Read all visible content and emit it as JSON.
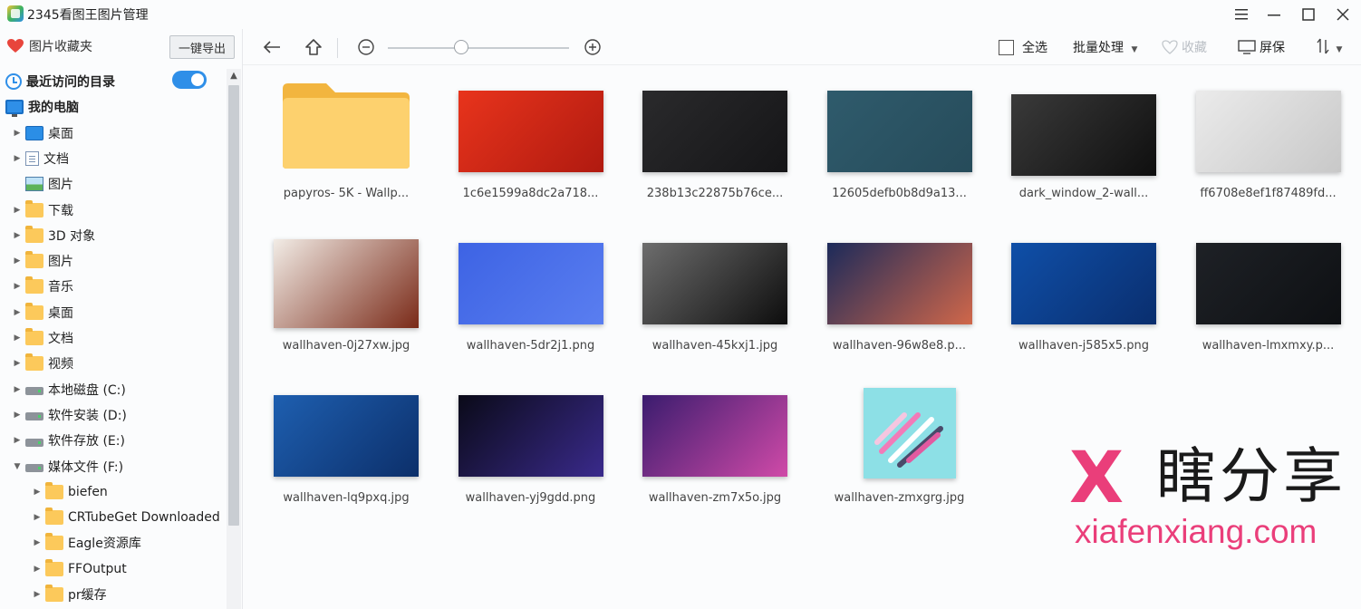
{
  "window": {
    "title": "2345看图王图片管理",
    "min_icon": "minimize-icon",
    "max_icon": "maximize-icon",
    "close_icon": "close-icon"
  },
  "sidebar": {
    "favorites_label": "图片收藏夹",
    "export_label": "一键导出",
    "tree": [
      {
        "label": "最近访问的目录",
        "icon": "clock-icon",
        "bold": true,
        "toggle": true
      },
      {
        "label": "我的电脑",
        "icon": "monitor-icon",
        "bold": true
      },
      {
        "label": "桌面",
        "icon": "desktop-icon",
        "arrow": "right"
      },
      {
        "label": "文档",
        "icon": "document-icon",
        "arrow": "right"
      },
      {
        "label": "图片",
        "icon": "picture-icon"
      },
      {
        "label": "下载",
        "icon": "folder-icon",
        "arrow": "right"
      },
      {
        "label": "3D 对象",
        "icon": "folder-icon",
        "arrow": "right"
      },
      {
        "label": "图片",
        "icon": "folder-icon",
        "arrow": "right"
      },
      {
        "label": "音乐",
        "icon": "folder-icon",
        "arrow": "right"
      },
      {
        "label": "桌面",
        "icon": "folder-icon",
        "arrow": "right"
      },
      {
        "label": "文档",
        "icon": "folder-icon",
        "arrow": "right"
      },
      {
        "label": "视频",
        "icon": "folder-icon",
        "arrow": "right"
      },
      {
        "label": "本地磁盘 (C:)",
        "icon": "drive-icon",
        "arrow": "right"
      },
      {
        "label": "软件安装 (D:)",
        "icon": "drive-icon",
        "arrow": "right"
      },
      {
        "label": "软件存放 (E:)",
        "icon": "drive-icon",
        "arrow": "right"
      },
      {
        "label": "媒体文件 (F:)",
        "icon": "drive-icon",
        "arrow": "down"
      },
      {
        "label": "biefen",
        "icon": "folder-icon",
        "arrow": "right",
        "level": 2
      },
      {
        "label": "CRTubeGet Downloaded",
        "icon": "folder-icon",
        "arrow": "right",
        "level": 2
      },
      {
        "label": "Eagle资源库",
        "icon": "folder-icon",
        "arrow": "right",
        "level": 2
      },
      {
        "label": "FFOutput",
        "icon": "folder-icon",
        "arrow": "right",
        "level": 2
      },
      {
        "label": "pr缓存",
        "icon": "folder-icon",
        "arrow": "right",
        "level": 2
      }
    ]
  },
  "toolbar": {
    "back_icon": "back-arrow-icon",
    "up_icon": "up-arrow-icon",
    "zoom_out_icon": "zoom-out-icon",
    "zoom_in_icon": "zoom-in-icon",
    "select_all_label": "全选",
    "batch_label": "批量处理",
    "favorite_label": "收藏",
    "fullscreen_label": "屏保",
    "sort_icon": "sort-icon"
  },
  "files": [
    {
      "name": "papyros- 5K - Wallp...",
      "type": "folder"
    },
    {
      "name": "1c6e1599a8dc2a718...",
      "colors": [
        "#e8341c",
        "#b01a10"
      ]
    },
    {
      "name": "238b13c22875b76ce...",
      "colors": [
        "#2a2a2c",
        "#151517"
      ]
    },
    {
      "name": "12605defb0b8d9a13...",
      "colors": [
        "#2f5b6c",
        "#264b5a"
      ]
    },
    {
      "name": "dark_window_2-wall...",
      "colors": [
        "#3a3a3a",
        "#0f0f0f"
      ]
    },
    {
      "name": "ff6708e8ef1f87489fd...",
      "colors": [
        "#ebebeb",
        "#c8c8c8"
      ]
    },
    {
      "name": "wallhaven-0j27xw.jpg",
      "colors": [
        "#f2ece6",
        "#7a2a18"
      ]
    },
    {
      "name": "wallhaven-5dr2j1.png",
      "colors": [
        "#3d63e4",
        "#5a7ef0"
      ]
    },
    {
      "name": "wallhaven-45kxj1.jpg",
      "colors": [
        "#6d6d6d",
        "#0d0d0d"
      ]
    },
    {
      "name": "wallhaven-96w8e8.p...",
      "colors": [
        "#1c2a5a",
        "#d0674a"
      ]
    },
    {
      "name": "wallhaven-j585x5.png",
      "colors": [
        "#0f4fa8",
        "#0a2e6e"
      ]
    },
    {
      "name": "wallhaven-lmxmxy.p...",
      "colors": [
        "#1e2126",
        "#0e1013"
      ]
    },
    {
      "name": "wallhaven-lq9pxq.jpg",
      "colors": [
        "#1e5fb0",
        "#0c2f6a"
      ]
    },
    {
      "name": "wallhaven-yj9gdd.png",
      "colors": [
        "#0a0a18",
        "#3a2a8c"
      ]
    },
    {
      "name": "wallhaven-zm7x5o.jpg",
      "colors": [
        "#3a1c6e",
        "#d04aa8"
      ]
    },
    {
      "name": "wallhaven-zmxgrg.jpg",
      "colors": [
        "#8de0e6",
        "#5ccad3"
      ]
    }
  ],
  "watermark": {
    "logo": "X",
    "chinese": "瞎分享",
    "url": "xiafenxiang.com"
  }
}
